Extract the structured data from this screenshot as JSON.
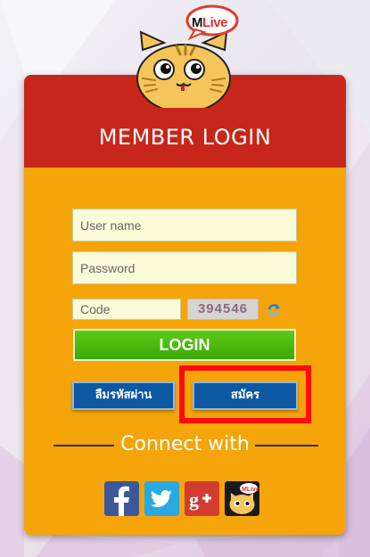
{
  "brand": {
    "prefix": "M",
    "suffix": "Live"
  },
  "header": {
    "title": "MEMBER LOGIN"
  },
  "form": {
    "username_placeholder": "User name",
    "password_placeholder": "Password",
    "code_placeholder": "Code",
    "captcha_value": "394546",
    "login_label": "LOGIN",
    "forgot_label": "ลืมรหัสผ่าน",
    "register_label": "สมัคร"
  },
  "connect": {
    "label": "Connect with"
  },
  "social": [
    "facebook-icon",
    "twitter-icon",
    "google-plus-icon",
    "mlive-icon"
  ],
  "colors": {
    "card": "#f5a40a",
    "header": "#c7271a",
    "login_button": "#3ba808",
    "blue_button": "#0d58a3",
    "highlight": "#ff0a0a"
  }
}
